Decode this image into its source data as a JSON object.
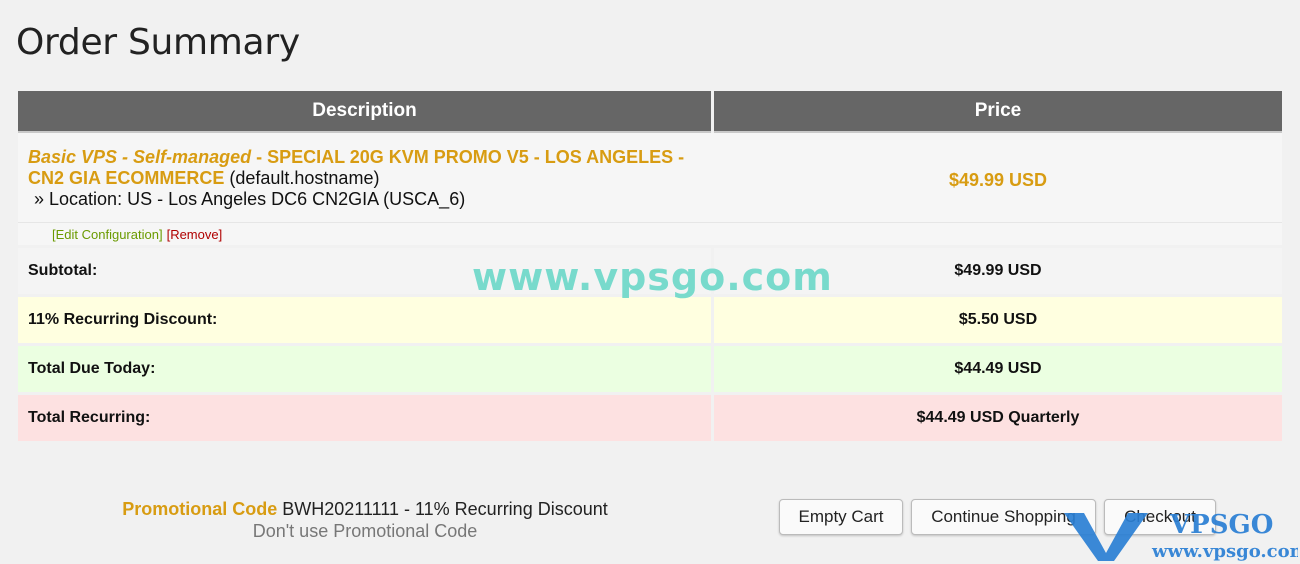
{
  "page_title": "Order Summary",
  "table": {
    "headers": {
      "description": "Description",
      "price": "Price"
    },
    "item": {
      "group": "Basic VPS - Self-managed",
      "separator": " - ",
      "product": "SPECIAL 20G KVM PROMO V5 - LOS ANGELES - CN2 GIA ECOMMERCE",
      "hostname": " (default.hostname)",
      "location": "» Location: US - Los Angeles DC6 CN2GIA (USCA_6)",
      "price": "$49.99 USD",
      "edit_link": "[Edit Configuration]",
      "remove_link": "[Remove]"
    },
    "subtotal": {
      "label": "Subtotal:",
      "value": "$49.99 USD"
    },
    "discount": {
      "label": "11% Recurring Discount:",
      "value": "$5.50 USD"
    },
    "total_due": {
      "label": "Total Due Today:",
      "value": "$44.49 USD"
    },
    "total_recurring": {
      "label": "Total Recurring:",
      "value": "$44.49 USD Quarterly"
    }
  },
  "promo": {
    "label": "Promotional Code",
    "code": " BWH20211111 - 11% Recurring Discount",
    "remove_link": "Don't use Promotional Code"
  },
  "buttons": {
    "empty_cart": "Empty Cart",
    "continue_shopping": "Continue Shopping",
    "checkout": "Checkout"
  },
  "watermark": {
    "center_text": "www.vpsgo.com",
    "logo_text": "VPSGO",
    "logo_url": "www.vpsgo.com",
    "logo_color": "#2a7fd4"
  },
  "colors": {
    "accent_gold": "#d89c12",
    "header_bg": "#666666",
    "discount_bg": "#ffffe0",
    "due_bg": "#ebffe1",
    "recurring_bg": "#fde1e1"
  }
}
